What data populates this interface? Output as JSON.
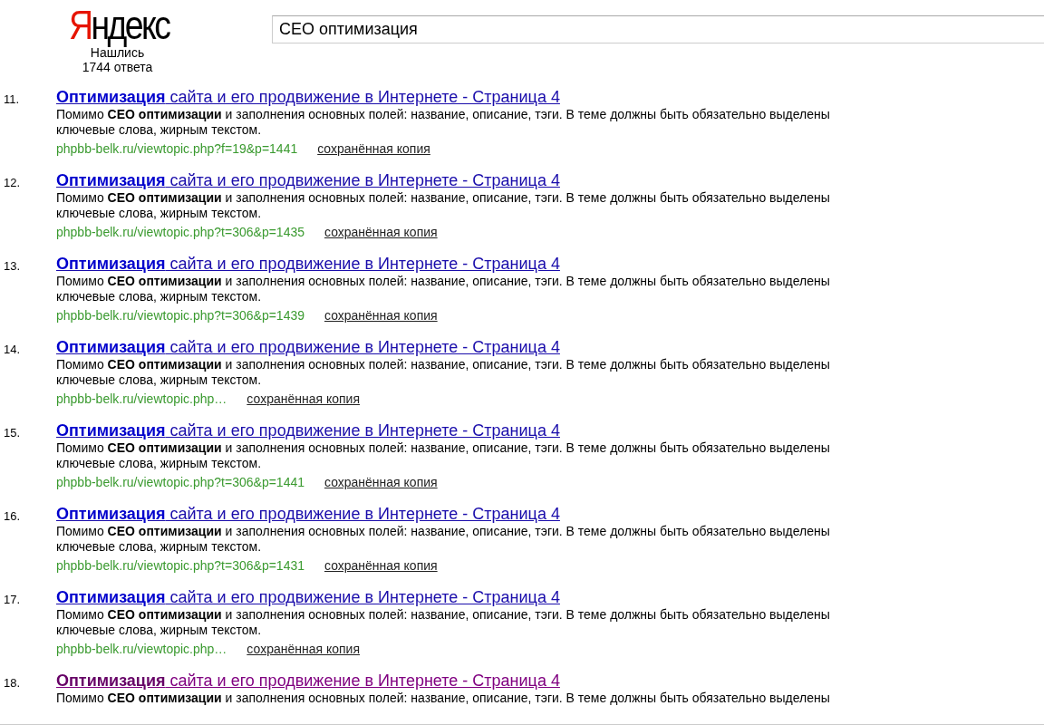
{
  "header": {
    "logo": "Яндекс",
    "found_label": "Нашлись",
    "found_count": "1744 ответа",
    "search": {
      "value": "СЕО оптимизация"
    }
  },
  "results": [
    {
      "number": "11.",
      "title": "**Оптимизация** сайта и его продвижение в Интернете - Страница 4",
      "visited": false,
      "snippet": "Помимо **СЕО оптимизации** и заполнения основных полей: название, описание, тэги. В теме должны быть обязательно выделены ключевые слова, жирным текстом.",
      "url": "phpbb-belk.ru/viewtopic.php?f=19&p=1441",
      "cache_link": "сохранённая копия"
    },
    {
      "number": "12.",
      "title": "**Оптимизация** сайта и его продвижение в Интернете - Страница 4",
      "visited": false,
      "snippet": "Помимо **СЕО оптимизации** и заполнения основных полей: название, описание, тэги. В теме должны быть обязательно выделены ключевые слова, жирным текстом.",
      "url": "phpbb-belk.ru/viewtopic.php?t=306&p=1435",
      "cache_link": "сохранённая копия"
    },
    {
      "number": "13.",
      "title": "**Оптимизация** сайта и его продвижение в Интернете - Страница 4",
      "visited": false,
      "snippet": "Помимо **СЕО оптимизации** и заполнения основных полей: название, описание, тэги. В теме должны быть обязательно выделены ключевые слова, жирным текстом.",
      "url": "phpbb-belk.ru/viewtopic.php?t=306&p=1439",
      "cache_link": "сохранённая копия"
    },
    {
      "number": "14.",
      "title": "**Оптимизация** сайта и его продвижение в Интернете - Страница 4",
      "visited": false,
      "snippet": "Помимо **СЕО оптимизации** и заполнения основных полей: название, описание, тэги. В теме должны быть обязательно выделены ключевые слова, жирным текстом.",
      "url": "phpbb-belk.ru/viewtopic.php…",
      "cache_link": "сохранённая копия"
    },
    {
      "number": "15.",
      "title": "**Оптимизация** сайта и его продвижение в Интернете - Страница 4",
      "visited": false,
      "snippet": "Помимо **СЕО оптимизации** и заполнения основных полей: название, описание, тэги. В теме должны быть обязательно выделены ключевые слова, жирным текстом.",
      "url": "phpbb-belk.ru/viewtopic.php?t=306&p=1441",
      "cache_link": "сохранённая копия"
    },
    {
      "number": "16.",
      "title": "**Оптимизация** сайта и его продвижение в Интернете - Страница 4",
      "visited": false,
      "snippet": "Помимо **СЕО оптимизации** и заполнения основных полей: название, описание, тэги. В теме должны быть обязательно выделены ключевые слова, жирным текстом.",
      "url": "phpbb-belk.ru/viewtopic.php?t=306&p=1431",
      "cache_link": "сохранённая копия"
    },
    {
      "number": "17.",
      "title": "**Оптимизация** сайта и его продвижение в Интернете - Страница 4",
      "visited": false,
      "snippet": "Помимо **СЕО оптимизации** и заполнения основных полей: название, описание, тэги. В теме должны быть обязательно выделены ключевые слова, жирным текстом.",
      "url": "phpbb-belk.ru/viewtopic.php…",
      "cache_link": "сохранённая копия"
    },
    {
      "number": "18.",
      "title": "**Оптимизация** сайта и его продвижение в Интернете - Страница 4",
      "visited": true,
      "snippet": "Помимо **СЕО оптимизации** и заполнения основных полей: название, описание, тэги. В теме должны быть обязательно выделены"
    }
  ]
}
